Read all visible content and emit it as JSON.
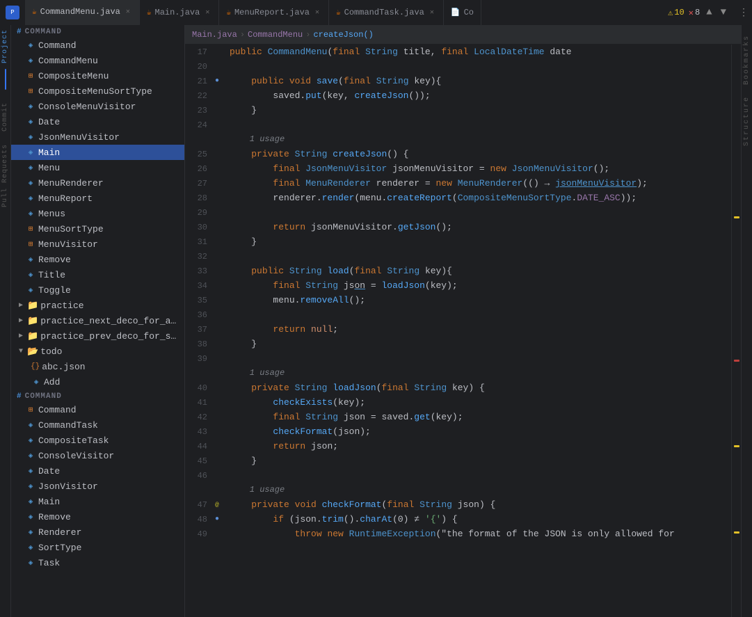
{
  "tabs": [
    {
      "id": "commandmenu",
      "label": "CommandMenu.java",
      "active": true,
      "icon": "java"
    },
    {
      "id": "main",
      "label": "Main.java",
      "active": false,
      "icon": "java"
    },
    {
      "id": "menureport",
      "label": "MenuReport.java",
      "active": false,
      "icon": "java"
    },
    {
      "id": "commandtask",
      "label": "CommandTask.java",
      "active": false,
      "icon": "java"
    },
    {
      "id": "co",
      "label": "Co",
      "active": false,
      "icon": "java"
    }
  ],
  "status": {
    "warnings": "10",
    "errors": "8"
  },
  "sidebar": {
    "title": "Project",
    "items": [
      {
        "level": 1,
        "type": "class",
        "color": "blue",
        "label": "Command"
      },
      {
        "level": 1,
        "type": "class",
        "color": "blue",
        "label": "CommandMenu"
      },
      {
        "level": 1,
        "type": "class",
        "color": "orange",
        "label": "CompositeMenu"
      },
      {
        "level": 1,
        "type": "class",
        "color": "orange",
        "label": "CompositeMenuSortType"
      },
      {
        "level": 1,
        "type": "class",
        "color": "blue",
        "label": "ConsoleMenuVisitor"
      },
      {
        "level": 1,
        "type": "class",
        "color": "blue",
        "label": "Date"
      },
      {
        "level": 1,
        "type": "class",
        "color": "blue",
        "label": "JsonMenuVisitor"
      },
      {
        "level": 1,
        "type": "class",
        "color": "blue",
        "label": "Main",
        "active": true
      },
      {
        "level": 1,
        "type": "class",
        "color": "blue",
        "label": "Menu"
      },
      {
        "level": 1,
        "type": "class",
        "color": "blue",
        "label": "MenuRenderer"
      },
      {
        "level": 1,
        "type": "class",
        "color": "blue",
        "label": "MenuReport"
      },
      {
        "level": 1,
        "type": "class",
        "color": "blue",
        "label": "Menus"
      },
      {
        "level": 1,
        "type": "class",
        "color": "orange",
        "label": "MenuSortType"
      },
      {
        "level": 1,
        "type": "class",
        "color": "orange",
        "label": "MenuVisitor"
      },
      {
        "level": 1,
        "type": "class",
        "color": "blue",
        "label": "Remove"
      },
      {
        "level": 1,
        "type": "class",
        "color": "blue",
        "label": "Title"
      },
      {
        "level": 1,
        "type": "class",
        "color": "blue",
        "label": "Toggle"
      },
      {
        "level": 0,
        "type": "folder",
        "color": "yellow",
        "label": "practice",
        "collapsed": true
      },
      {
        "level": 0,
        "type": "folder",
        "color": "yellow",
        "label": "practice_next_deco_for_add",
        "collapsed": true
      },
      {
        "level": 0,
        "type": "folder",
        "color": "yellow",
        "label": "practice_prev_deco_for_sect",
        "collapsed": true
      },
      {
        "level": 0,
        "type": "folder",
        "color": "yellow",
        "label": "todo",
        "collapsed": false
      },
      {
        "level": 1,
        "type": "json",
        "color": "yellow",
        "label": "abc.json"
      },
      {
        "level": 1,
        "type": "class",
        "color": "blue",
        "label": "Add"
      },
      {
        "level": 1,
        "type": "class",
        "color": "orange",
        "label": "Command"
      },
      {
        "level": 1,
        "type": "class",
        "color": "blue",
        "label": "CommandTask"
      },
      {
        "level": 1,
        "type": "class",
        "color": "blue",
        "label": "CompositeTask"
      },
      {
        "level": 1,
        "type": "class",
        "color": "blue",
        "label": "ConsoleVisitor"
      },
      {
        "level": 1,
        "type": "class",
        "color": "blue",
        "label": "Date"
      },
      {
        "level": 1,
        "type": "class",
        "color": "blue",
        "label": "JsonVisitor"
      },
      {
        "level": 1,
        "type": "class",
        "color": "blue",
        "label": "Main"
      },
      {
        "level": 1,
        "type": "class",
        "color": "blue",
        "label": "Remove"
      },
      {
        "level": 1,
        "type": "class",
        "color": "blue",
        "label": "Renderer"
      },
      {
        "level": 1,
        "type": "class",
        "color": "blue",
        "label": "SortType"
      },
      {
        "level": 1,
        "type": "class",
        "color": "blue",
        "label": "Task"
      }
    ]
  },
  "code_lines": [
    {
      "ln": "17",
      "has_bookmark": false,
      "has_dot": false,
      "content": "    <kw>public</kw> <type>CommandMenu</type>(<kw>final</kw> <type>String</type> title, <kw>final</kw> <type>LocalDateTime</type> date"
    },
    {
      "ln": "20",
      "has_bookmark": false,
      "has_dot": false,
      "content": ""
    },
    {
      "ln": "21",
      "has_bookmark": false,
      "has_dot": true,
      "content": "    <kw>public</kw> <kw>void</kw> <fn>save</fn>(<kw>final</kw> <type>String</type> key){"
    },
    {
      "ln": "22",
      "has_bookmark": false,
      "has_dot": false,
      "content": "        saved.<fn>put</fn>(key, <fn>createJson</fn>());"
    },
    {
      "ln": "23",
      "has_bookmark": false,
      "has_dot": false,
      "content": "    }"
    },
    {
      "ln": "24",
      "has_bookmark": false,
      "has_dot": false,
      "content": ""
    },
    {
      "ln": "",
      "has_bookmark": false,
      "has_dot": false,
      "usage": true,
      "content": "    1 usage"
    },
    {
      "ln": "25",
      "has_bookmark": false,
      "has_dot": false,
      "content": "    <kw>private</kw> <type>String</type> <fn>createJson</fn>() {"
    },
    {
      "ln": "26",
      "has_bookmark": false,
      "has_dot": false,
      "content": "        <kw>final</kw> <type>JsonMenuVisitor</type> jsonMenuVisitor = <kw>new</kw> <type>JsonMenuVisitor</type>();"
    },
    {
      "ln": "27",
      "has_bookmark": false,
      "has_dot": false,
      "content": "        <kw>final</kw> <type>MenuRenderer</type> renderer = <kw>new</kw> <type>MenuRenderer</type>(() → <fn>jsonMenuVisitor</fn>);"
    },
    {
      "ln": "28",
      "has_bookmark": false,
      "has_dot": false,
      "content": "        renderer.<fn>render</fn>(menu.<fn>createReport</fn>(<type>CompositeMenuSortType</type>.<var>DATE_ASC</var>));"
    },
    {
      "ln": "29",
      "has_bookmark": false,
      "has_dot": false,
      "content": ""
    },
    {
      "ln": "30",
      "has_bookmark": false,
      "has_dot": false,
      "content": "        <kw>return</kw> jsonMenuVisitor.<fn>getJson</fn>();"
    },
    {
      "ln": "31",
      "has_bookmark": false,
      "has_dot": false,
      "content": "    }"
    },
    {
      "ln": "32",
      "has_bookmark": false,
      "has_dot": false,
      "content": ""
    },
    {
      "ln": "33",
      "has_bookmark": false,
      "has_dot": false,
      "content": "    <kw>public</kw> <type>String</type> <fn>load</fn>(<kw>final</kw> <type>String</type> key){"
    },
    {
      "ln": "34",
      "has_bookmark": false,
      "has_dot": false,
      "content": "        <kw>final</kw> <type>String</type> json = <fn>loadJson</fn>(key);"
    },
    {
      "ln": "35",
      "has_bookmark": false,
      "has_dot": false,
      "content": "        menu.<fn>removeAll</fn>();"
    },
    {
      "ln": "36",
      "has_bookmark": false,
      "has_dot": false,
      "content": ""
    },
    {
      "ln": "37",
      "has_bookmark": false,
      "has_dot": false,
      "content": "        <kw>return</kw> <kw2>null</kw2>;"
    },
    {
      "ln": "38",
      "has_bookmark": false,
      "has_dot": false,
      "content": "    }"
    },
    {
      "ln": "39",
      "has_bookmark": false,
      "has_dot": false,
      "content": ""
    },
    {
      "ln": "",
      "has_bookmark": false,
      "has_dot": false,
      "usage": true,
      "content": "    1 usage"
    },
    {
      "ln": "40",
      "has_bookmark": false,
      "has_dot": false,
      "content": "    <kw>private</kw> <type>String</type> <fn>loadJson</fn>(<kw>final</kw> <type>String</type> key) {"
    },
    {
      "ln": "41",
      "has_bookmark": false,
      "has_dot": false,
      "content": "        <fn>checkExists</fn>(key);"
    },
    {
      "ln": "42",
      "has_bookmark": false,
      "has_dot": false,
      "content": "        <kw>final</kw> <type>String</type> json = saved.<fn>get</fn>(key);"
    },
    {
      "ln": "43",
      "has_bookmark": false,
      "has_dot": false,
      "content": "        <fn>checkFormat</fn>(json);"
    },
    {
      "ln": "44",
      "has_bookmark": false,
      "has_dot": false,
      "content": "        <kw>return</kw> json;"
    },
    {
      "ln": "45",
      "has_bookmark": false,
      "has_dot": false,
      "content": "    }"
    },
    {
      "ln": "46",
      "has_bookmark": false,
      "has_dot": false,
      "content": ""
    },
    {
      "ln": "",
      "has_bookmark": false,
      "has_dot": false,
      "usage": true,
      "content": "    1 usage"
    },
    {
      "ln": "47",
      "has_bookmark": false,
      "has_dot": true,
      "annot": "@",
      "content": "    <kw>private</kw> <kw>void</kw> <fn>checkFormat</fn>(<kw>final</kw> <type>String</type> json) {"
    },
    {
      "ln": "48",
      "has_bookmark": false,
      "has_dot": true,
      "content": "        <kw>if</kw> (json.<fn>trim</fn>().<fn>charAt</fn>(0) ≠ <str>'{'</str>) {"
    },
    {
      "ln": "49",
      "has_bookmark": false,
      "has_dot": false,
      "content": "            <kw>throw</kw> <kw>new</kw> <type>RuntimeException</type>(\"the format of the JSON is only allowed for"
    }
  ],
  "sidebar_labels": {
    "project": "Project",
    "commit": "Commit",
    "pull_requests": "Pull Requests",
    "bookmarks": "Bookmarks",
    "structure": "Structure"
  }
}
